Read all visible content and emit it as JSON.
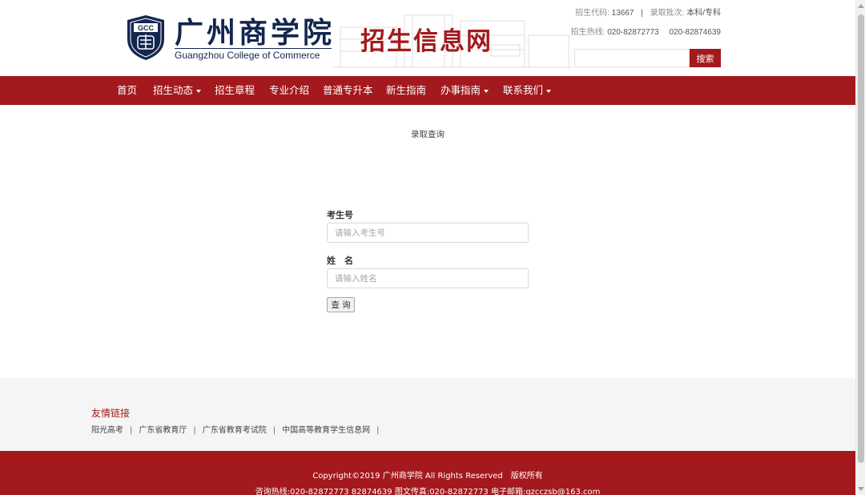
{
  "header": {
    "logo_text": "GCC",
    "school_name_cn": "广州商学院",
    "school_name_en": "Guangzhou College of Commerce",
    "site_title": "招生信息网",
    "code_label": "招生代码:",
    "code_value": "13667",
    "batch_label": "录取批次:",
    "batch_value": "本科/专科",
    "hotline_label": "招生热线:",
    "hotline_1": "020-82872773",
    "hotline_2": "020-82874639",
    "search_value": "",
    "search_button": "搜索"
  },
  "nav": {
    "items": [
      {
        "label": "首页",
        "dropdown": false
      },
      {
        "label": "招生动态",
        "dropdown": true
      },
      {
        "label": "招生章程",
        "dropdown": false
      },
      {
        "label": "专业介绍",
        "dropdown": false
      },
      {
        "label": "普通专升本",
        "dropdown": false
      },
      {
        "label": "新生指南",
        "dropdown": false
      },
      {
        "label": "办事指南",
        "dropdown": true
      },
      {
        "label": "联系我们",
        "dropdown": true
      }
    ]
  },
  "main": {
    "title": "录取查询",
    "exam_no_label": "考生号",
    "exam_no_placeholder": "请输入考生号",
    "name_label": "姓　名",
    "name_placeholder": "请输入姓名",
    "submit_label": "查 询"
  },
  "links": {
    "title": "友情链接",
    "items": [
      "阳光高考",
      "广东省教育厅",
      "广东省教育考试院",
      "中国高等教育学生信息网"
    ],
    "divider": "|"
  },
  "footer": {
    "line1": "Copyright©2019 广州商学院 All Rights Reserved　版权所有",
    "line2": "咨询热线:020-82872773 82874639 图文传真:020-82872773 电子邮箱:gzcczsb@163.com"
  },
  "colors": {
    "brand_red": "#a3191d",
    "logo_navy": "#14264f"
  }
}
